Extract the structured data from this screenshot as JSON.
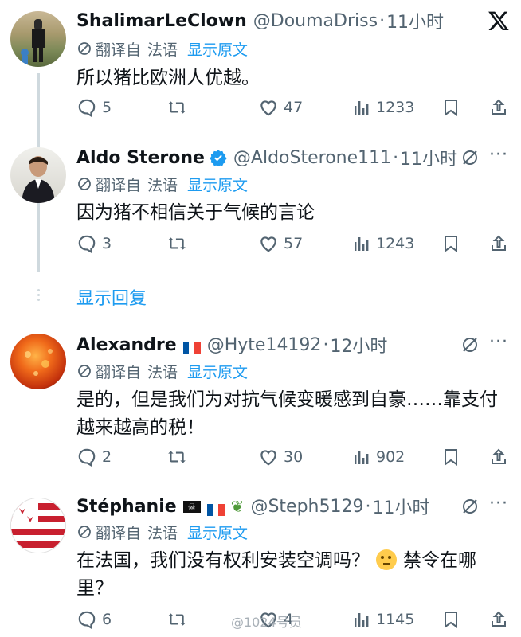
{
  "colors": {
    "accent": "#1d9bf0",
    "secondary_text": "#536471",
    "primary_text": "#0f1419",
    "verified": "#1d9bf0"
  },
  "translation": {
    "translated_from": "翻译自",
    "language": "法语",
    "show_original": "显示原文"
  },
  "show_replies": "显示回复",
  "tweets": [
    {
      "name": "ShalimarLeClown",
      "handle": "@DoumaDriss",
      "time": "11小时",
      "text": "所以猪比欧洲人优越。",
      "replies": "5",
      "likes": "47",
      "views": "1233"
    },
    {
      "name": "Aldo Sterone",
      "handle": "@AldoSterone111",
      "time": "11小时",
      "text": "因为猪不相信关于气候的言论",
      "replies": "3",
      "likes": "57",
      "views": "1243"
    },
    {
      "name": "Alexandre",
      "handle": "@Hyte14192",
      "time": "12小时",
      "text": "是的，但是我们为对抗气候变暖感到自豪……靠支付越来越高的税！",
      "replies": "2",
      "likes": "30",
      "views": "902"
    },
    {
      "name": "Stéphanie",
      "handle": "@Steph5129",
      "time": "11小时",
      "text": "在法国，我们没有权利安装空调吗？",
      "text_after_emoji": "禁令在哪里？",
      "replies": "6",
      "likes": "4",
      "views": "1145"
    }
  ],
  "watermark": "@1024号员"
}
